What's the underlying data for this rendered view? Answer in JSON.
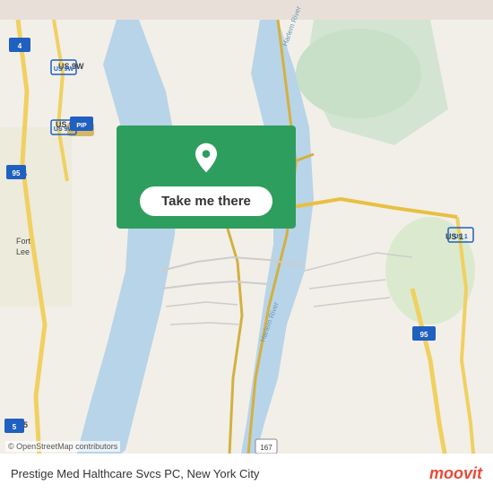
{
  "map": {
    "background_color": "#e8e0d8",
    "center_lat": 40.837,
    "center_lon": -73.933
  },
  "overlay": {
    "button_label": "Take me there",
    "pin_color": "white",
    "box_color": "#2e9e5e"
  },
  "bottom_bar": {
    "location_text": "Prestige Med Halthcare Svcs PC, New York City",
    "logo_text": "moovit",
    "osm_text": "© OpenStreetMap contributors"
  },
  "icons": {
    "location_pin": "📍"
  }
}
